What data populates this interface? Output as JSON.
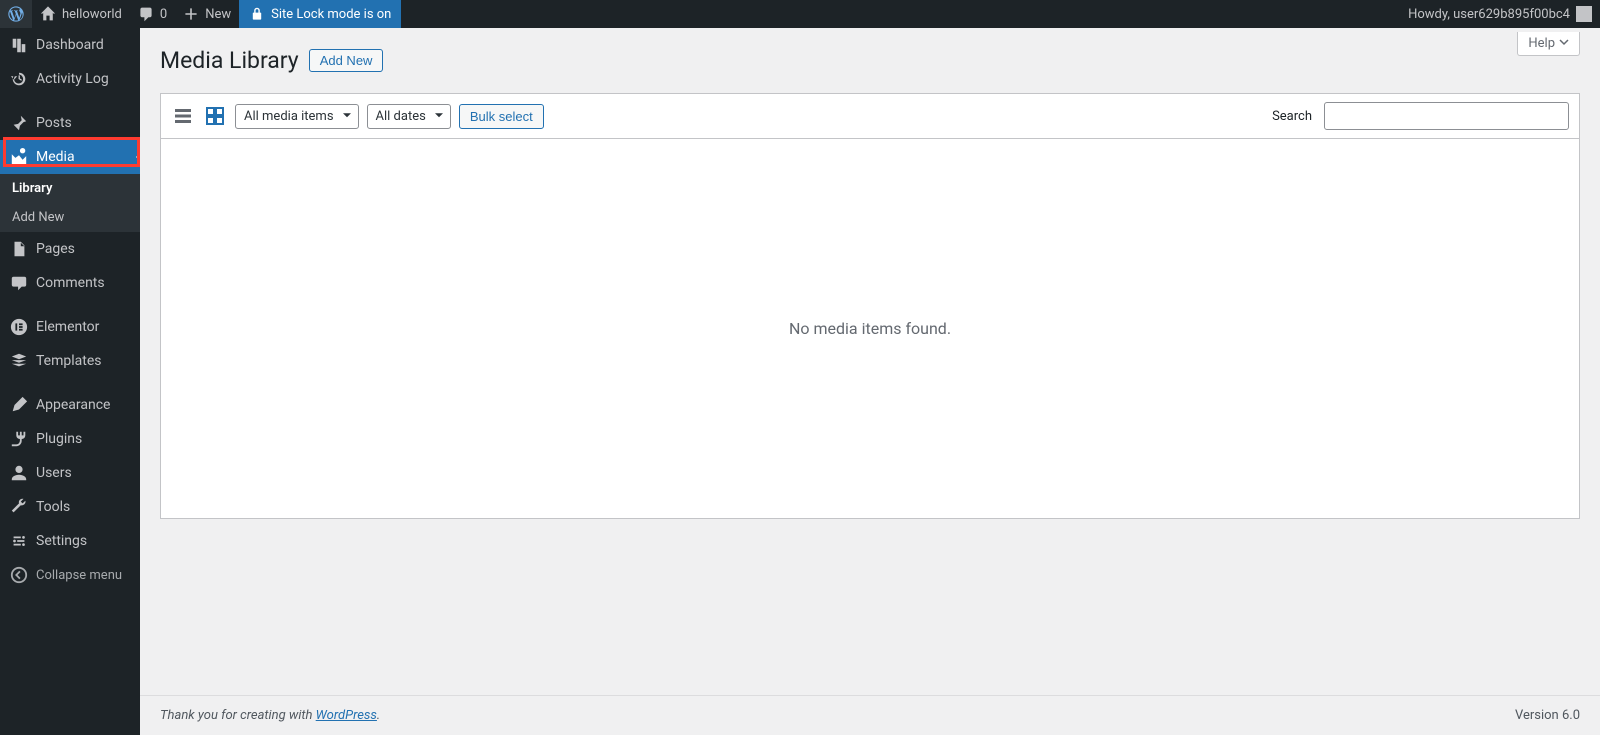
{
  "adminbar": {
    "site_name": "helloworld",
    "comments_count": "0",
    "new_label": "New",
    "site_lock_label": "Site Lock mode is on",
    "howdy_text": "Howdy, user629b895f00bc4"
  },
  "sidebar": {
    "items": {
      "dashboard": "Dashboard",
      "activity_log": "Activity Log",
      "posts": "Posts",
      "media": "Media",
      "pages": "Pages",
      "comments": "Comments",
      "elementor": "Elementor",
      "templates": "Templates",
      "appearance": "Appearance",
      "plugins": "Plugins",
      "users": "Users",
      "tools": "Tools",
      "settings": "Settings"
    },
    "media_submenu": {
      "library": "Library",
      "add_new": "Add New"
    },
    "collapse": "Collapse menu"
  },
  "page": {
    "title": "Media Library",
    "add_new": "Add New",
    "help": "Help",
    "filter_type": "All media items",
    "filter_date": "All dates",
    "bulk_select": "Bulk select",
    "search_label": "Search",
    "no_items": "No media items found."
  },
  "footer": {
    "thanks_prefix": "Thank you for creating with ",
    "thanks_link": "WordPress",
    "thanks_suffix": ".",
    "version": "Version 6.0"
  }
}
